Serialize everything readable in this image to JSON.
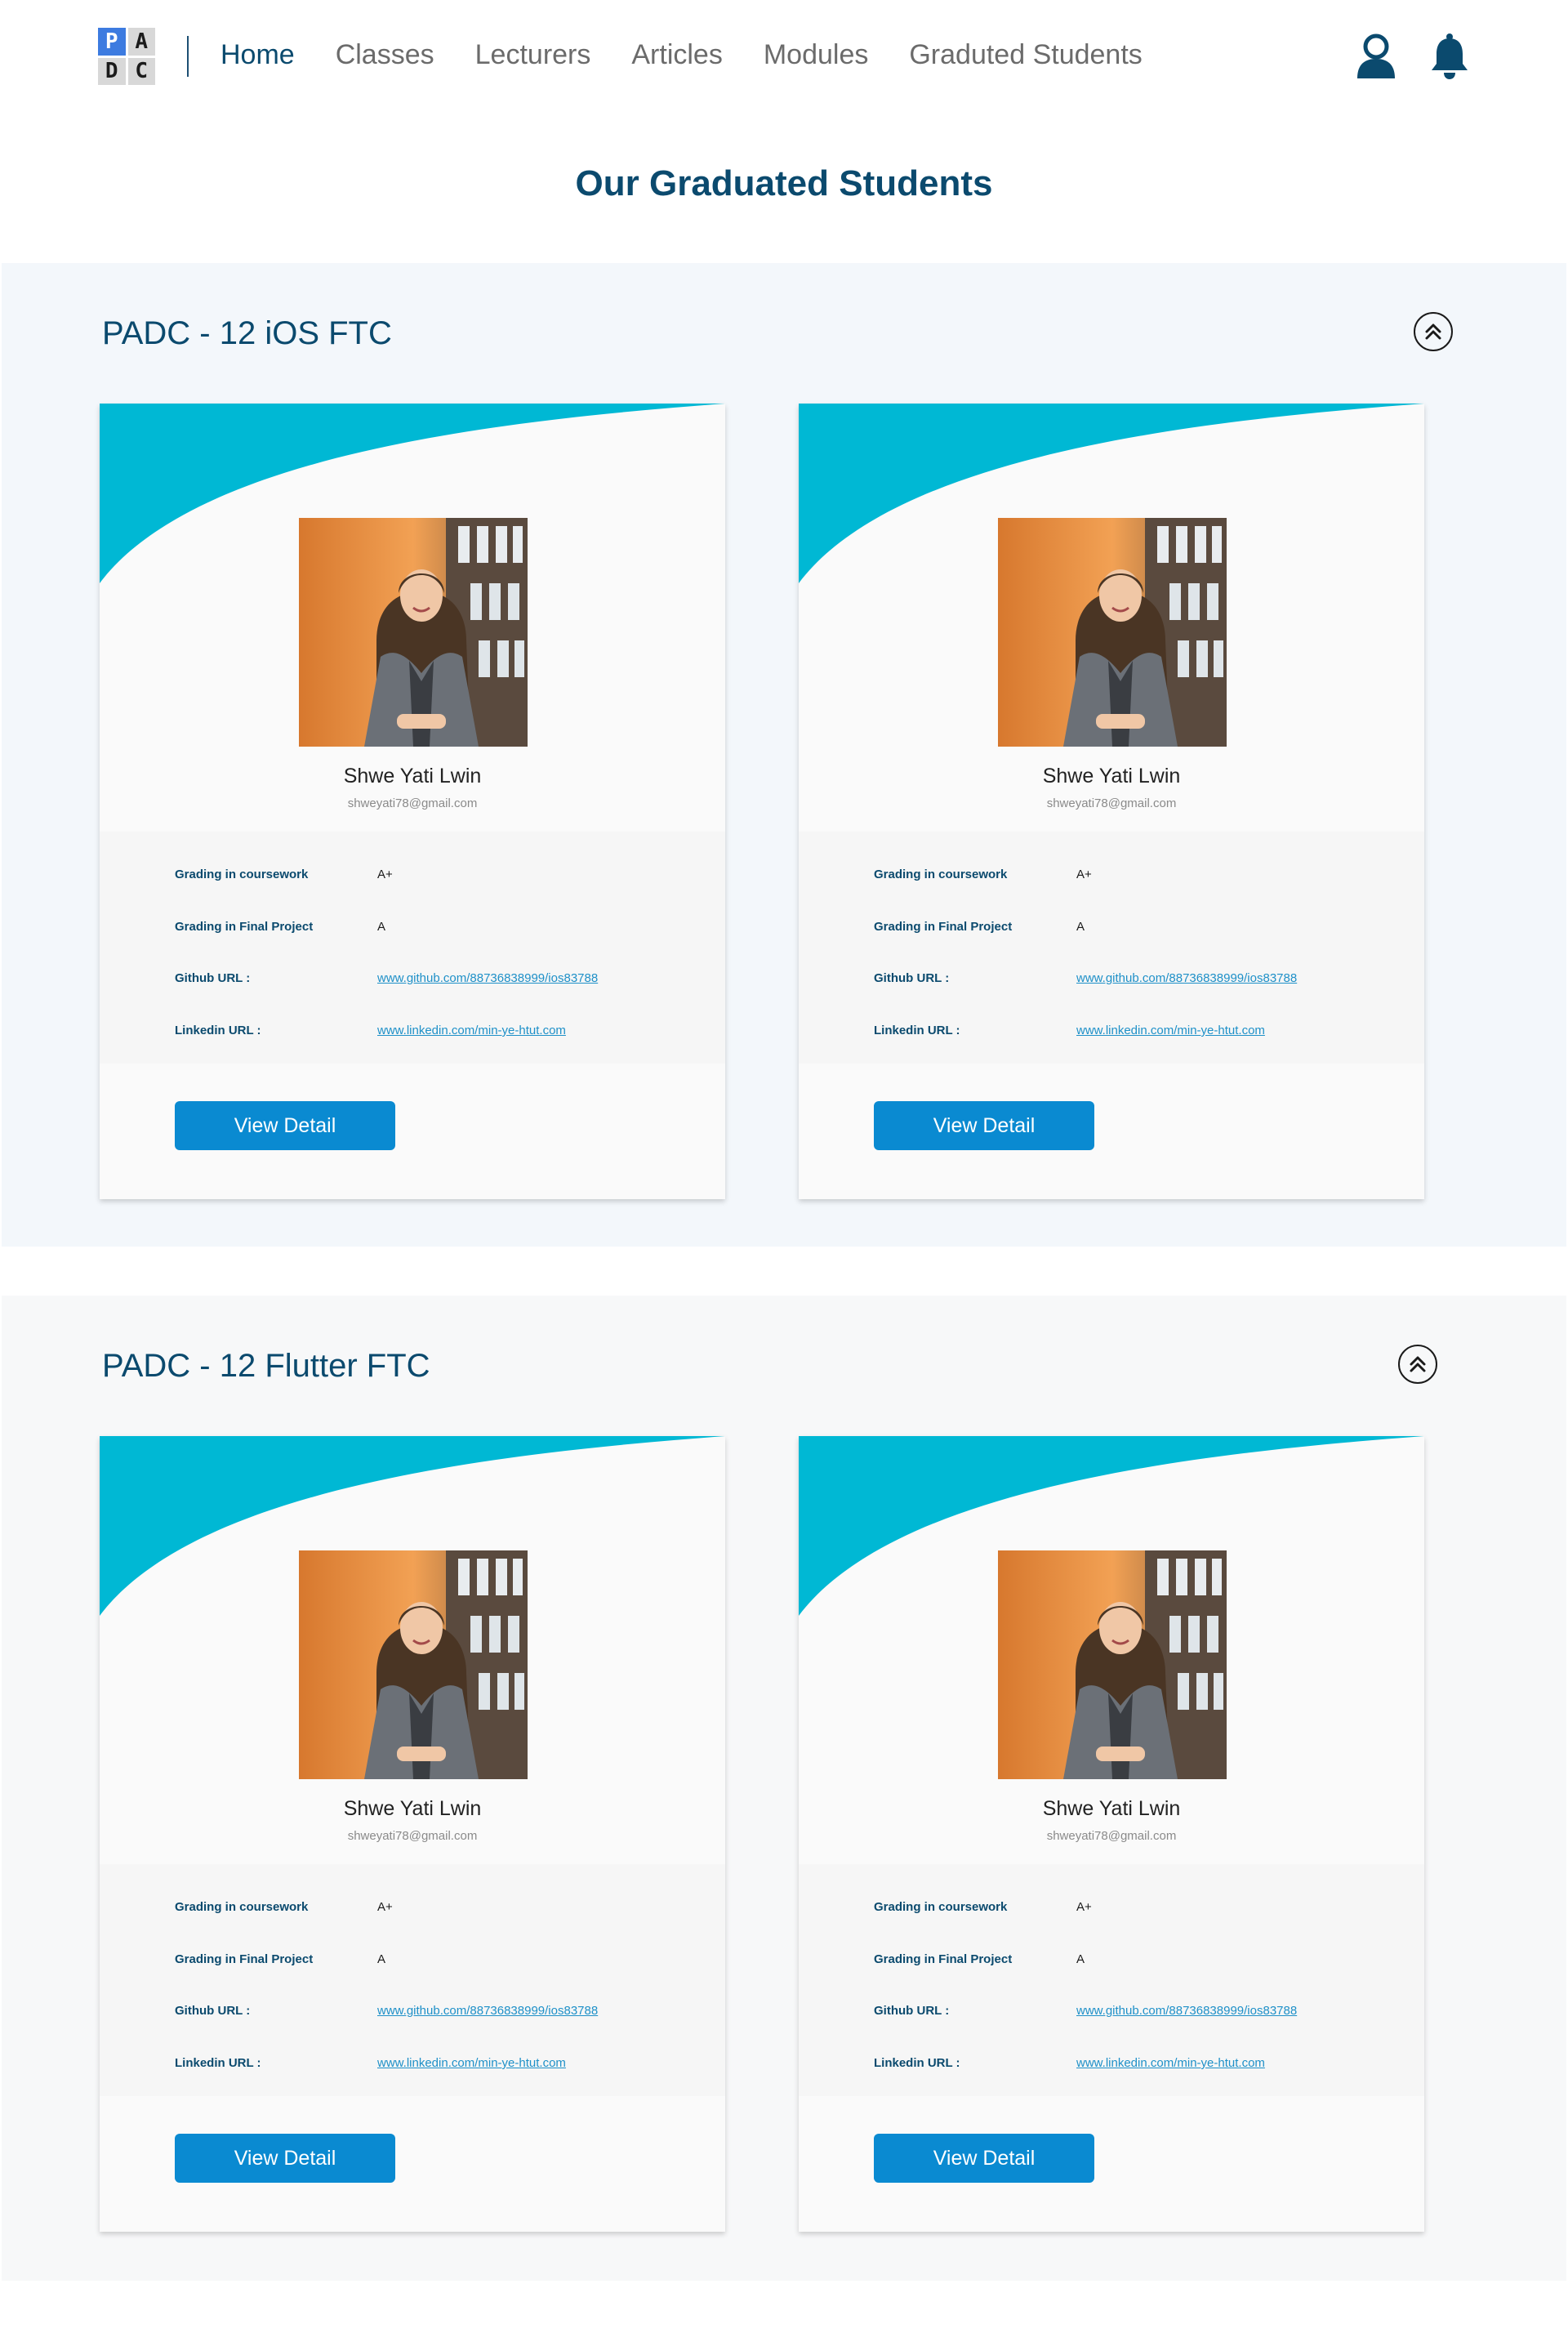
{
  "logo": {
    "letters": [
      "P",
      "A",
      "D",
      "C"
    ]
  },
  "nav": {
    "links": [
      "Home",
      "Classes",
      "Lecturers",
      "Articles",
      "Modules",
      "Graduted Students"
    ],
    "active": "Home"
  },
  "icons": {
    "user": "user-icon",
    "bell": "bell-icon",
    "collapse": "double-chevron-up-icon"
  },
  "colors": {
    "brand": "#0b4a6e",
    "accent": "#00b8d4",
    "button": "#0a8ad1",
    "link": "#1e90c8"
  },
  "page": {
    "title": "Our Graduated Students"
  },
  "sections": [
    {
      "title": "PADC - 12 iOS FTC",
      "students": [
        {
          "name": "Shwe Yati Lwin",
          "email": "shweyati78@gmail.com",
          "fields": [
            {
              "label": "Grading in coursework",
              "value": "A+"
            },
            {
              "label": "Grading in Final Project",
              "value": "A"
            },
            {
              "label": "Github URL :",
              "value": "www.github.com/88736838999/ios83788"
            },
            {
              "label": "Linkedin URL :",
              "value": "www.linkedin.com/min-ye-htut.com"
            }
          ],
          "button": "View Detail"
        },
        {
          "name": "Shwe Yati Lwin",
          "email": "shweyati78@gmail.com",
          "fields": [
            {
              "label": "Grading in coursework",
              "value": "A+"
            },
            {
              "label": "Grading in Final Project",
              "value": "A"
            },
            {
              "label": "Github URL :",
              "value": "www.github.com/88736838999/ios83788"
            },
            {
              "label": "Linkedin URL :",
              "value": "www.linkedin.com/min-ye-htut.com"
            }
          ],
          "button": "View Detail"
        }
      ]
    },
    {
      "title": "PADC - 12 Flutter FTC",
      "students": [
        {
          "name": "Shwe Yati Lwin",
          "email": "shweyati78@gmail.com",
          "fields": [
            {
              "label": "Grading in coursework",
              "value": "A+"
            },
            {
              "label": "Grading in Final Project",
              "value": "A"
            },
            {
              "label": "Github URL :",
              "value": "www.github.com/88736838999/ios83788"
            },
            {
              "label": "Linkedin URL :",
              "value": "www.linkedin.com/min-ye-htut.com"
            }
          ],
          "button": "View Detail"
        },
        {
          "name": "Shwe Yati Lwin",
          "email": "shweyati78@gmail.com",
          "fields": [
            {
              "label": "Grading in coursework",
              "value": "A+"
            },
            {
              "label": "Grading in Final Project",
              "value": "A"
            },
            {
              "label": "Github URL :",
              "value": "www.github.com/88736838999/ios83788"
            },
            {
              "label": "Linkedin URL :",
              "value": "www.linkedin.com/min-ye-htut.com"
            }
          ],
          "button": "View Detail"
        }
      ]
    }
  ]
}
